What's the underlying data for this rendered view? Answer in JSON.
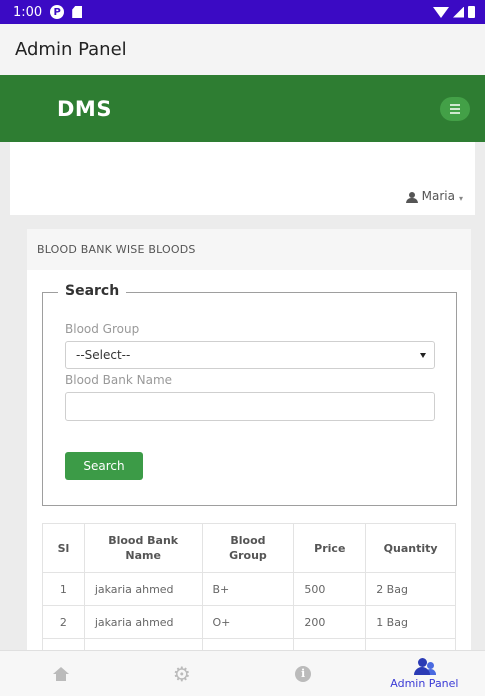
{
  "status_bar": {
    "time": "1:00",
    "p_icon": "P"
  },
  "app_bar": {
    "title": "Admin Panel"
  },
  "header": {
    "brand": "DMS"
  },
  "user": {
    "name": "Maria",
    "caret": "▾"
  },
  "panel": {
    "heading": "BLOOD BANK WISE BLOODS",
    "search": {
      "legend": "Search",
      "blood_group_label": "Blood Group",
      "blood_group_value": "--Select--",
      "blood_bank_name_label": "Blood Bank Name",
      "blood_bank_name_value": "",
      "button_label": "Search"
    },
    "table": {
      "headers": [
        "Sl",
        "Blood Bank Name",
        "Blood Group",
        "Price",
        "Quantity"
      ],
      "rows": [
        [
          "1",
          "jakaria ahmed",
          "B+",
          "500",
          "2 Bag"
        ],
        [
          "2",
          "jakaria ahmed",
          "O+",
          "200",
          "1 Bag"
        ]
      ]
    }
  },
  "bottom_nav": {
    "items": [
      {
        "icon": "home-icon"
      },
      {
        "icon": "gear-icon",
        "glyph": "⚙"
      },
      {
        "icon": "info-icon",
        "glyph": "i"
      },
      {
        "icon": "admin-users-icon",
        "label": "Admin Panel"
      }
    ]
  },
  "colors": {
    "status_bar": "#3b0ac4",
    "header_green": "#2e7d32",
    "search_button": "#3c9b47",
    "nav_active": "#3b3bd6"
  }
}
